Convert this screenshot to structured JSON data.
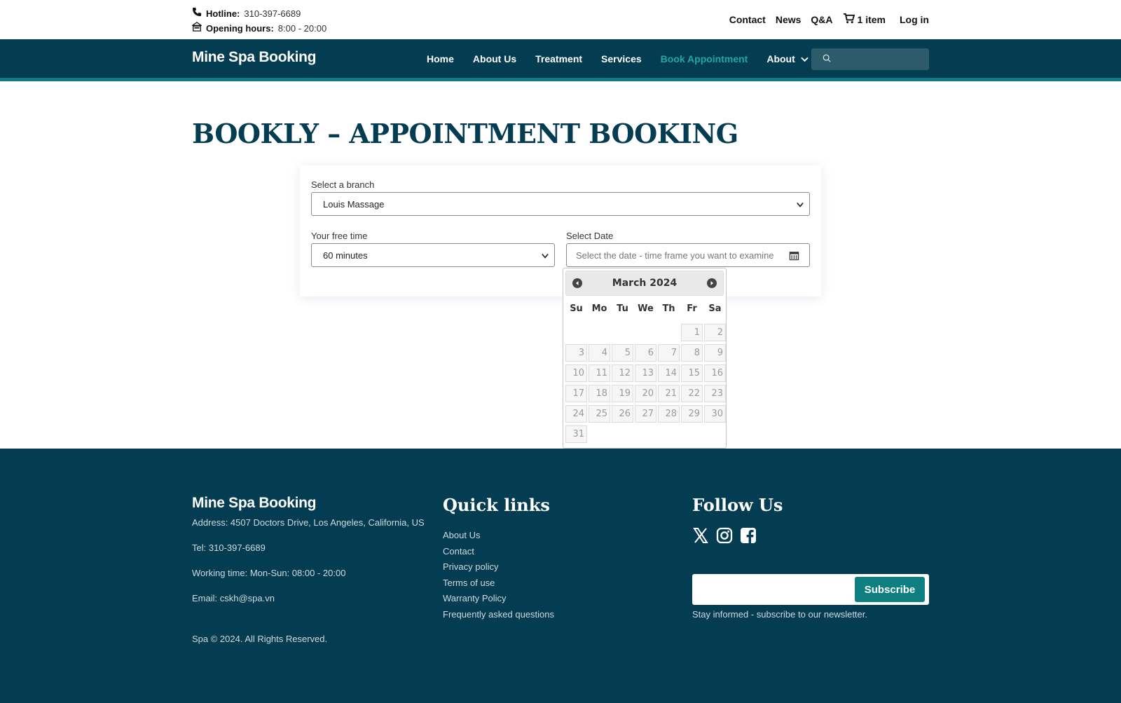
{
  "topbar": {
    "hotline_label": "Hotline:",
    "hotline_value": "310-397-6689",
    "hours_label": "Opening hours:",
    "hours_value": "8:00 - 20:00",
    "links": [
      "Contact",
      "News",
      "Q&A"
    ],
    "cart_label": "1 item",
    "login_label": "Log in"
  },
  "nav": {
    "brand": "Mine Spa Booking",
    "items": [
      "Home",
      "About Us",
      "Treatment",
      "Services",
      "Book Appointment",
      "About"
    ],
    "active": "Book Appointment",
    "search_placeholder": ""
  },
  "page": {
    "title": "BOOKLY – APPOINTMENT BOOKING"
  },
  "form": {
    "branch_label": "Select a branch",
    "branch_value": "Louis Massage",
    "free_time_label": "Your free time",
    "free_time_value": "60 minutes",
    "date_label": "Select Date",
    "date_placeholder": "Select the date - time frame you want to examine"
  },
  "datepicker": {
    "month_title": "March 2024",
    "weekdays": [
      "Su",
      "Mo",
      "Tu",
      "We",
      "Th",
      "Fr",
      "Sa"
    ],
    "leading_blanks": 5,
    "days": [
      "1",
      "2",
      "3",
      "4",
      "5",
      "6",
      "7",
      "8",
      "9",
      "10",
      "11",
      "12",
      "13",
      "14",
      "15",
      "16",
      "17",
      "18",
      "19",
      "20",
      "21",
      "22",
      "23",
      "24",
      "25",
      "26",
      "27",
      "28",
      "29",
      "30",
      "31"
    ]
  },
  "footer": {
    "brand": "Mine Spa Booking",
    "address": "Address: 4507 Doctors Drive, Los Angeles, California, US",
    "tel": "Tel: 310-397-6689",
    "working_time": "Working time: Mon-Sun: 08:00 - 20:00",
    "email": "Email: cskh@spa.vn",
    "copyright": "Spa © 2024. All Rights Reserved.",
    "quick_links_title": "Quick links",
    "quick_links": [
      "About Us",
      "Contact",
      "Privacy policy",
      "Terms of use",
      "Warranty Policy",
      "Frequently asked questions"
    ],
    "follow_title": "Follow Us",
    "social_icons": [
      "x-icon",
      "instagram-icon",
      "facebook-icon"
    ],
    "subscribe_label": "Subscribe",
    "subscribe_note": "Stay informed - subscribe to our newsletter."
  },
  "colors": {
    "primary": "#043d51",
    "accent": "#0e7e80",
    "active_nav": "#1fa7a8"
  }
}
